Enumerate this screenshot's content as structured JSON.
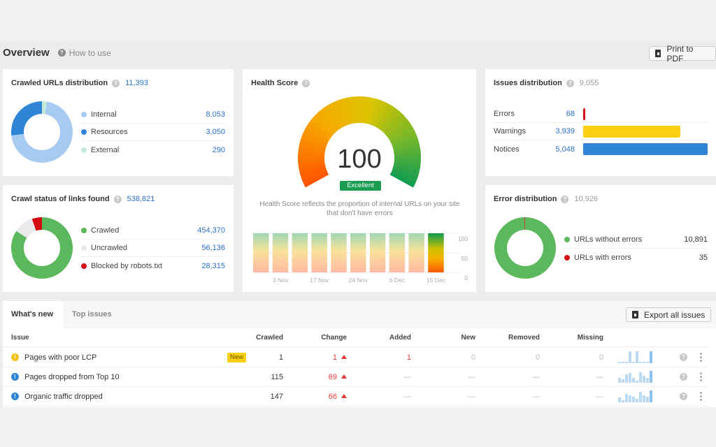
{
  "header": {
    "title": "Overview",
    "how_to_use": "How to use",
    "print_button": "Print to PDF"
  },
  "crawled_urls": {
    "title": "Crawled URLs distribution",
    "total": "11,393",
    "items": [
      {
        "label": "Internal",
        "value": "8,053",
        "n": 8053,
        "color": "#a7cbf0"
      },
      {
        "label": "Resources",
        "value": "3,050",
        "n": 3050,
        "color": "#2f84d6"
      },
      {
        "label": "External",
        "value": "290",
        "n": 290,
        "color": "#c6ead6"
      }
    ]
  },
  "crawl_status": {
    "title": "Crawl status of links found",
    "total": "538,821",
    "items": [
      {
        "label": "Crawled",
        "value": "454,370",
        "n": 454370,
        "color": "#5cb85c"
      },
      {
        "label": "Uncrawled",
        "value": "56,136",
        "n": 56136,
        "color": "#e9eaec"
      },
      {
        "label": "Blocked by robots.txt",
        "value": "28,315",
        "n": 28315,
        "color": "#d40f14"
      }
    ]
  },
  "health_score": {
    "title": "Health Score",
    "score": "100",
    "rating": "Excellent",
    "description": "Health Score reflects the proportion of internal URLs on your site that don't have errors",
    "history": {
      "y_ticks": [
        "100",
        "50",
        "0"
      ],
      "x_ticks": [
        "3 Nov",
        "17 Nov",
        "24 Nov",
        "6 Dec",
        "15 Dec"
      ],
      "values": [
        100,
        100,
        100,
        100,
        100,
        100,
        100,
        100,
        100,
        100
      ],
      "ylim": [
        0,
        100
      ]
    }
  },
  "issues_distribution": {
    "title": "Issues distribution",
    "total": "9,055",
    "items": [
      {
        "label": "Errors",
        "value": "68",
        "n": 68,
        "color": "#d40f14"
      },
      {
        "label": "Warnings",
        "value": "3,939",
        "n": 3939,
        "color": "#fcd012"
      },
      {
        "label": "Notices",
        "value": "5,048",
        "n": 5048,
        "color": "#2f84d6"
      }
    ]
  },
  "error_distribution": {
    "title": "Error distribution",
    "total": "10,926",
    "items": [
      {
        "label": "URLs without errors",
        "value": "10,891",
        "n": 10891,
        "color": "#5cb85c"
      },
      {
        "label": "URLs with errors",
        "value": "35",
        "n": 35,
        "color": "#d40f14"
      }
    ]
  },
  "issues_table": {
    "tabs": [
      "What's new",
      "Top issues"
    ],
    "export_button": "Export all issues",
    "columns": [
      "Issue",
      "Crawled",
      "Change",
      "Added",
      "New",
      "Removed",
      "Missing"
    ],
    "rows": [
      {
        "severity": "warning",
        "issue": "Pages with poor LCP",
        "badge": "New",
        "crawled": "1",
        "change": "1",
        "added": "1",
        "new": "0",
        "removed": "0",
        "missing": "0",
        "trend": [
          1,
          1,
          1,
          10,
          1,
          10,
          1,
          1,
          1,
          10
        ]
      },
      {
        "severity": "notice",
        "issue": "Pages dropped from Top 10",
        "badge": "",
        "crawled": "115",
        "change": "69",
        "added": "—",
        "new": "—",
        "removed": "—",
        "missing": "—",
        "trend": [
          4,
          3,
          7,
          8,
          4,
          2,
          9,
          6,
          4,
          10
        ]
      },
      {
        "severity": "notice",
        "issue": "Organic traffic dropped",
        "badge": "",
        "crawled": "147",
        "change": "66",
        "added": "—",
        "new": "—",
        "removed": "—",
        "missing": "—",
        "trend": [
          4,
          2,
          7,
          6,
          5,
          3,
          9,
          6,
          5,
          10
        ]
      }
    ]
  },
  "colors": {
    "link_blue": "#2a6fc9",
    "excellent_green": "#1a9c53",
    "change_red": "#e53935",
    "new_badge_yellow": "#fcd012"
  }
}
